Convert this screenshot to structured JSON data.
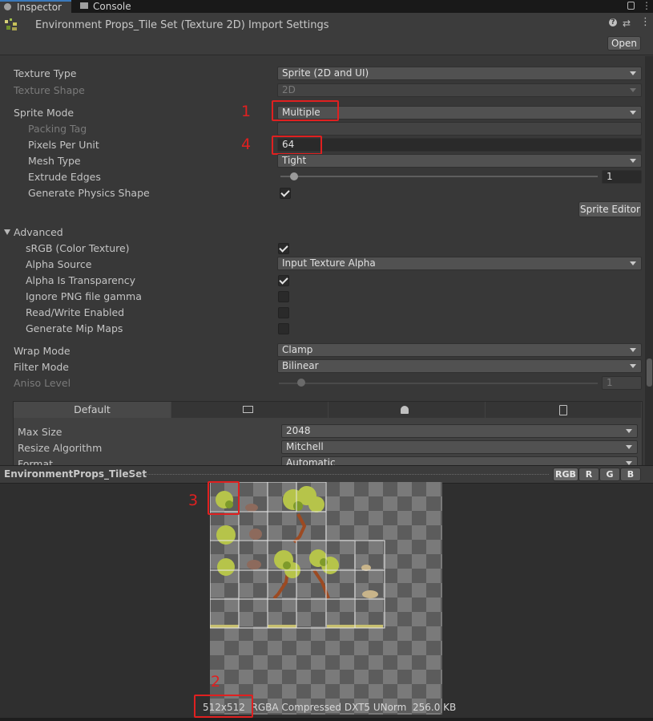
{
  "tabs": {
    "inspector": "Inspector",
    "console": "Console"
  },
  "header": {
    "title": "Environment Props_Tile Set (Texture 2D) Import Settings",
    "open_button": "Open"
  },
  "props": {
    "texture_type": {
      "label": "Texture Type",
      "value": "Sprite (2D and UI)"
    },
    "texture_shape": {
      "label": "Texture Shape",
      "value": "2D"
    },
    "sprite_mode": {
      "label": "Sprite Mode",
      "value": "Multiple"
    },
    "packing_tag": {
      "label": "Packing Tag",
      "value": ""
    },
    "pixels_per_unit": {
      "label": "Pixels Per Unit",
      "value": "64"
    },
    "mesh_type": {
      "label": "Mesh Type",
      "value": "Tight"
    },
    "extrude_edges": {
      "label": "Extrude Edges",
      "value": "1"
    },
    "generate_physics_shape": {
      "label": "Generate Physics Shape",
      "checked": true
    },
    "sprite_editor_button": "Sprite Editor"
  },
  "advanced": {
    "title": "Advanced",
    "srgb": {
      "label": "sRGB (Color Texture)",
      "checked": true
    },
    "alpha_source": {
      "label": "Alpha Source",
      "value": "Input Texture Alpha"
    },
    "alpha_is_transparency": {
      "label": "Alpha Is Transparency",
      "checked": true
    },
    "ignore_png_gamma": {
      "label": "Ignore PNG file gamma",
      "checked": false
    },
    "read_write": {
      "label": "Read/Write Enabled",
      "checked": false
    },
    "mip_maps": {
      "label": "Generate Mip Maps",
      "checked": false
    }
  },
  "wrap_mode": {
    "label": "Wrap Mode",
    "value": "Clamp"
  },
  "filter_mode": {
    "label": "Filter Mode",
    "value": "Bilinear"
  },
  "aniso_level": {
    "label": "Aniso Level",
    "value": "1"
  },
  "platform": {
    "tabs": [
      "Default"
    ],
    "icons": [
      "monitor-icon",
      "android-icon",
      "webgl-icon"
    ],
    "max_size": {
      "label": "Max Size",
      "value": "2048"
    },
    "resize_algorithm": {
      "label": "Resize Algorithm",
      "value": "Mitchell"
    },
    "format": {
      "label": "Format",
      "value": "Automatic"
    }
  },
  "preview": {
    "title": "EnvironmentProps_TileSet",
    "channels": [
      "RGB",
      "R",
      "G",
      "B"
    ],
    "info": "512x512  RGBA Compressed DXT5 UNorm  256.0 KB"
  },
  "annotations": [
    "1",
    "2",
    "3",
    "4"
  ],
  "colors": {
    "accent_tab": "#3a79bb",
    "annotation": "#e02020",
    "panel": "#383838"
  }
}
